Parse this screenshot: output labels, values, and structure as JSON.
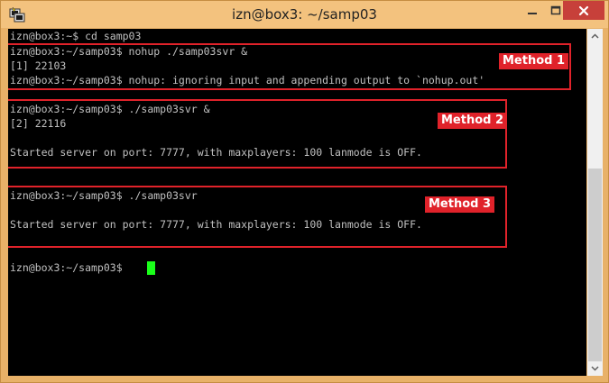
{
  "window": {
    "title": "izn@box3: ~/samp03"
  },
  "icons": {
    "app": "putty-icon",
    "minimize": "minimize-icon",
    "maximize": "maximize-icon",
    "close": "close-icon",
    "scroll_up": "chevron-up-icon",
    "scroll_down": "chevron-down-icon"
  },
  "colors": {
    "annotation_red": "#e0222a",
    "cursor_green": "#1aff1a",
    "terminal_bg": "#000000",
    "terminal_fg": "#c0c0c0"
  },
  "terminal": {
    "lines": [
      "izn@box3:~$ cd samp03",
      "izn@box3:~/samp03$ nohup ./samp03svr &",
      "[1] 22103",
      "izn@box3:~/samp03$ nohup: ignoring input and appending output to `nohup.out'",
      "izn@box3:~/samp03$ ./samp03svr &",
      "[2] 22116",
      "Started server on port: 7777, with maxplayers: 100 lanmode is OFF.",
      "izn@box3:~/samp03$ ./samp03svr",
      "Started server on port: 7777, with maxplayers: 100 lanmode is OFF.",
      "izn@box3:~/samp03$ "
    ]
  },
  "annotations": {
    "method1": "Method 1",
    "method2": "Method 2",
    "method3": "Method 3"
  }
}
